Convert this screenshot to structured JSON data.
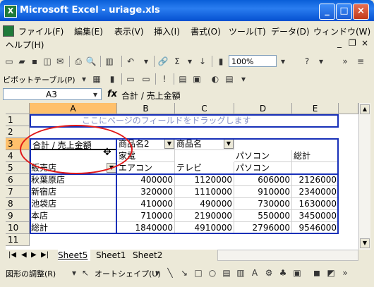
{
  "window": {
    "title": "Microsoft Excel - uriage.xls",
    "app_icon": "X"
  },
  "menu": {
    "items": [
      "ファイル(F)",
      "編集(E)",
      "表示(V)",
      "挿入(I)",
      "書式(O)",
      "ツール(T)",
      "データ(D)",
      "ウィンドウ(W)",
      "ヘルプ(H)"
    ]
  },
  "toolbar1": {
    "zoom": "100%"
  },
  "toolbar2": {
    "pivot_label": "ピボットテーブル(P)"
  },
  "formula": {
    "name": "A3",
    "fx": "fx",
    "value": "合計 / 売上金額"
  },
  "grid": {
    "columns": [
      "A",
      "B",
      "C",
      "D",
      "E"
    ],
    "rows": [
      "1",
      "2",
      "3",
      "4",
      "5",
      "6",
      "7",
      "8",
      "9",
      "10",
      "11"
    ],
    "ghost_text": "ここにページのフィールドをドラッグします",
    "row3": {
      "a": "合計 / 売上金額",
      "b": "商品名2",
      "c": "商品名"
    },
    "row4": {
      "b": "家電",
      "d": "パソコン",
      "e": "総計"
    },
    "row5": {
      "a": "販売店",
      "b": "エアコン",
      "c": "テレビ",
      "d": "パソコン"
    },
    "data": [
      {
        "store": "秋葉原店",
        "b": "400000",
        "c": "1120000",
        "d": "606000",
        "e": "2126000"
      },
      {
        "store": "新宿店",
        "b": "320000",
        "c": "1110000",
        "d": "910000",
        "e": "2340000"
      },
      {
        "store": "池袋店",
        "b": "410000",
        "c": "490000",
        "d": "730000",
        "e": "1630000"
      },
      {
        "store": "本店",
        "b": "710000",
        "c": "2190000",
        "d": "550000",
        "e": "3450000"
      },
      {
        "store": "総計",
        "b": "1840000",
        "c": "4910000",
        "d": "2796000",
        "e": "9546000"
      }
    ]
  },
  "tabs": {
    "sheets": [
      "Sheet5",
      "Sheet1",
      "Sheet2"
    ],
    "active": "Sheet5"
  },
  "drawing": {
    "figure_adjust": "図形の調整(R)",
    "autoshape": "オートシェイプ(U)"
  }
}
